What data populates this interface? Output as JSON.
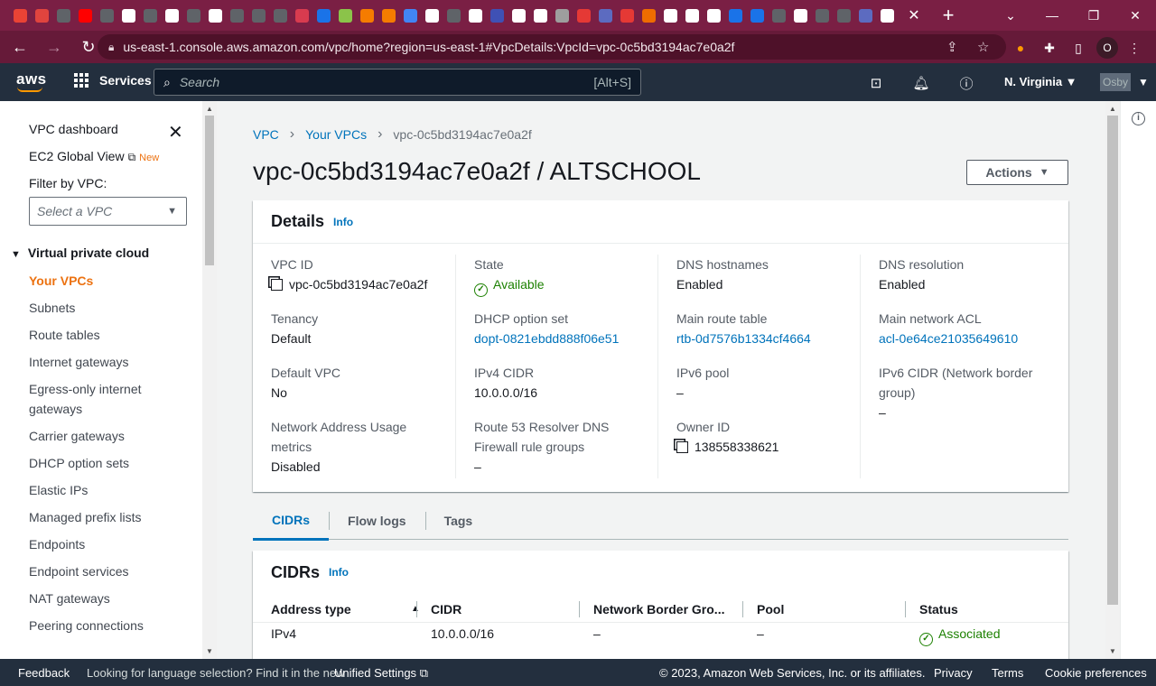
{
  "browser": {
    "url": "us-east-1.console.aws.amazon.com/vpc/home?region=us-east-1#VpcDetails:VpcId=vpc-0c5bd3194ac7e0a2f",
    "profile_initial": "O",
    "tab_icon_colors": [
      "#ea4335",
      "#e0443e",
      "#5f6368",
      "#ff0000",
      "#5f6368",
      "#ffffff",
      "#5f6368",
      "#ffffff",
      "#5f6368",
      "#ffffff",
      "#5f6368",
      "#5f6368",
      "#5f6368",
      "#d83b4f",
      "#1a73e8",
      "#8bc34a",
      "#f57c00",
      "#f57c00",
      "#4285f4",
      "#ffffff",
      "#5f6368",
      "#ffffff",
      "#3f51b5",
      "#ffffff",
      "#ffffff",
      "#9e9e9e",
      "#e53935",
      "#5c6bc0",
      "#e53935",
      "#ef6c00",
      "#ffffff",
      "#ffffff",
      "#ffffff",
      "#1a73e8",
      "#1a73e8",
      "#5f6368",
      "#ffffff",
      "#5f6368",
      "#5f6368",
      "#5c6bc0",
      "#ffffff"
    ]
  },
  "aws_nav": {
    "logo": "aws",
    "services_label": "Services",
    "search_placeholder": "Search",
    "search_shortcut": "[Alt+S]",
    "region": "N. Virginia ▼",
    "account": "Osby"
  },
  "sidebar": {
    "dashboard": "VPC dashboard",
    "ec2_global_view": "EC2 Global View",
    "new_badge": "New",
    "filter_label": "Filter by VPC:",
    "filter_placeholder": "Select a VPC",
    "section_title": "Virtual private cloud",
    "items": [
      {
        "label": "Your VPCs",
        "active": true
      },
      {
        "label": "Subnets"
      },
      {
        "label": "Route tables"
      },
      {
        "label": "Internet gateways"
      },
      {
        "label": "Egress-only internet gateways"
      },
      {
        "label": "Carrier gateways"
      },
      {
        "label": "DHCP option sets"
      },
      {
        "label": "Elastic IPs"
      },
      {
        "label": "Managed prefix lists"
      },
      {
        "label": "Endpoints"
      },
      {
        "label": "Endpoint services"
      },
      {
        "label": "NAT gateways"
      },
      {
        "label": "Peering connections"
      }
    ]
  },
  "breadcrumbs": [
    "VPC",
    "Your VPCs",
    "vpc-0c5bd3194ac7e0a2f"
  ],
  "page_title": "vpc-0c5bd3194ac7e0a2f / ALTSCHOOL",
  "actions_label": "Actions",
  "details": {
    "title": "Details",
    "info": "Info",
    "columns": [
      [
        {
          "label": "VPC ID",
          "value": "vpc-0c5bd3194ac7e0a2f"
        },
        {
          "label": "Tenancy",
          "value": "Default"
        },
        {
          "label": "Default VPC",
          "value": "No"
        },
        {
          "label": "Network Address Usage metrics",
          "value": "Disabled"
        }
      ],
      [
        {
          "label": "State",
          "value": "Available"
        },
        {
          "label": "DHCP option set",
          "value": "dopt-0821ebdd888f06e51"
        },
        {
          "label": "IPv4 CIDR",
          "value": "10.0.0.0/16"
        },
        {
          "label": "Route 53 Resolver DNS Firewall rule groups",
          "value": "–"
        }
      ],
      [
        {
          "label": "DNS hostnames",
          "value": "Enabled"
        },
        {
          "label": "Main route table",
          "value": "rtb-0d7576b1334cf4664"
        },
        {
          "label": "IPv6 pool",
          "value": "–"
        },
        {
          "label": "Owner ID",
          "value": "138558338621"
        }
      ],
      [
        {
          "label": "DNS resolution",
          "value": "Enabled"
        },
        {
          "label": "Main network ACL",
          "value": "acl-0e64ce21035649610"
        },
        {
          "label": "IPv6 CIDR (Network border group)",
          "value": "–"
        }
      ]
    ]
  },
  "tabs": [
    "CIDRs",
    "Flow logs",
    "Tags"
  ],
  "cidrs": {
    "title": "CIDRs",
    "info": "Info",
    "headers": [
      "Address type",
      "CIDR",
      "Network Border Gro...",
      "Pool",
      "Status"
    ],
    "rows": [
      [
        "IPv4",
        "10.0.0.0/16",
        "–",
        "–",
        "Associated"
      ]
    ]
  },
  "footer": {
    "feedback": "Feedback",
    "lang_text": "Looking for language selection? Find it in the new",
    "unified": "Unified Settings",
    "copyright": "© 2023, Amazon Web Services, Inc. or its affiliates.",
    "privacy": "Privacy",
    "terms": "Terms",
    "cookies": "Cookie preferences"
  },
  "colors": {
    "aws_nav_bg": "#232f3e",
    "aws_orange": "#ec7211",
    "link_blue": "#0073bb",
    "success_green": "#1d8102",
    "browser_frame": "#7a1f44"
  }
}
